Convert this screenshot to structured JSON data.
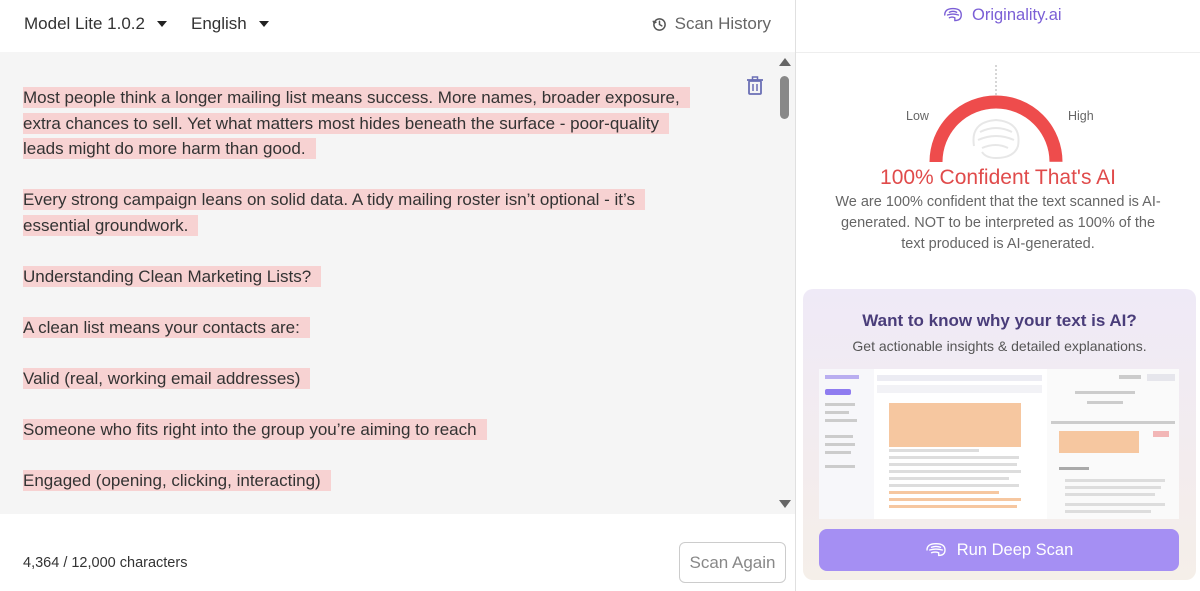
{
  "topbar": {
    "model_label": "Model Lite 1.0.2",
    "language_label": "English",
    "history_label": "Scan History"
  },
  "editor": {
    "paragraphs": [
      "Most people think a longer mailing list means success. More names, broader exposure, extra chances to sell. Yet what matters most hides beneath the surface - poor-quality leads might do more harm than good.",
      "Every strong campaign leans on solid data. A tidy mailing roster isn’t optional - it’s essential groundwork.",
      "Understanding Clean Marketing Lists?",
      "A clean list means your contacts are:",
      "Valid (real, working email addresses)",
      "Someone who fits right into the group you’re aiming to reach",
      "Engaged (opening, clicking, interacting)"
    ],
    "highlight_color": "#f7d2d2"
  },
  "bottombar": {
    "char_count": "4,364 / 12,000 characters",
    "scan_again_label": "Scan Again"
  },
  "result": {
    "brand": "Originality.ai",
    "low_label": "Low",
    "high_label": "High",
    "gauge_level": 1.0,
    "verdict": "100% Confident That's AI",
    "explanation": "We are 100% confident that the text scanned is AI-generated. NOT to be interpreted as 100% of the text produced is AI-generated.",
    "accent_color": "#e04b4b"
  },
  "promo": {
    "title": "Want to know why your text is AI?",
    "subtitle": "Get actionable insights & detailed explanations.",
    "button_label": "Run Deep Scan",
    "button_color": "#a58ff3"
  }
}
